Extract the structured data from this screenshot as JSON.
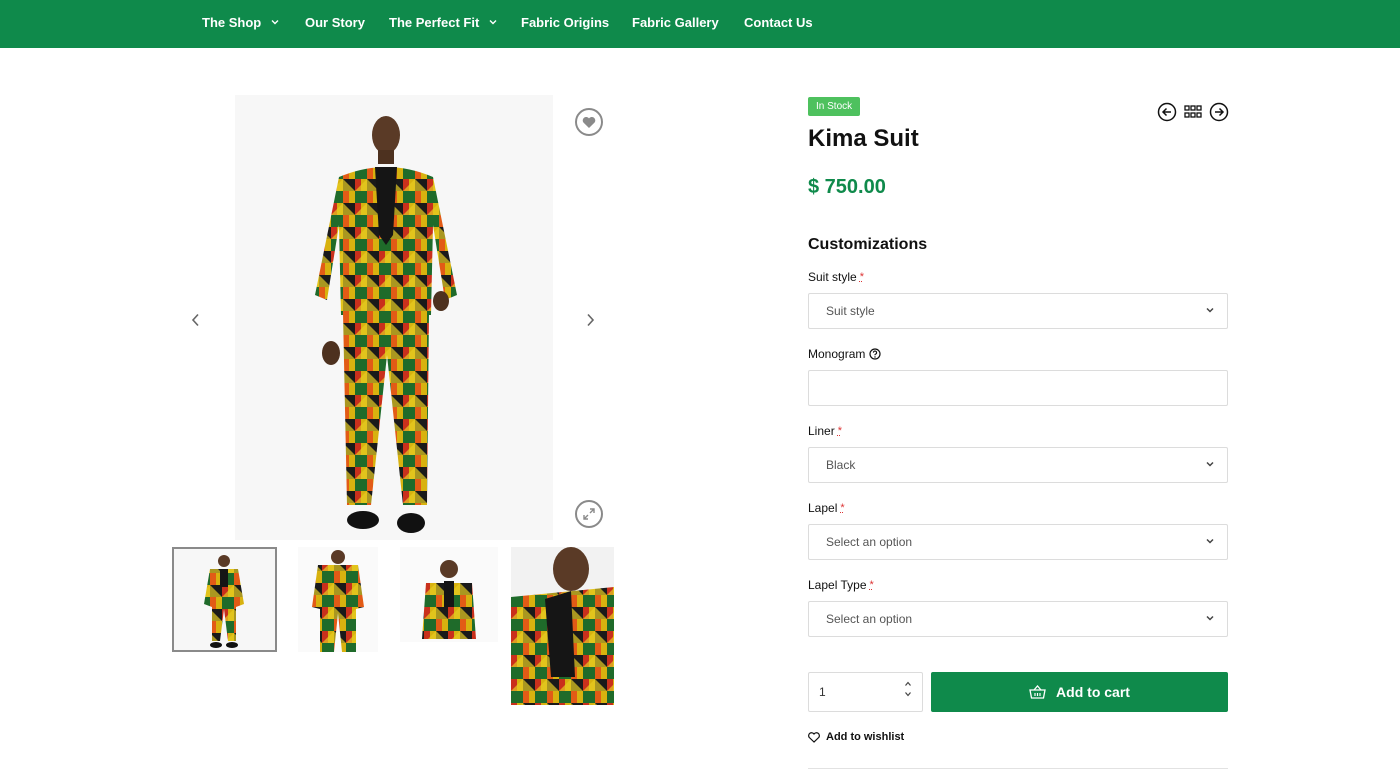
{
  "nav": {
    "items": [
      {
        "label": "The Shop",
        "has_dropdown": true
      },
      {
        "label": "Our Story",
        "has_dropdown": false
      },
      {
        "label": "The Perfect Fit",
        "has_dropdown": true
      },
      {
        "label": "Fabric Origins",
        "has_dropdown": false
      },
      {
        "label": "Fabric Gallery",
        "has_dropdown": false
      },
      {
        "label": "Contact Us",
        "has_dropdown": false
      }
    ]
  },
  "product": {
    "stock_badge": "In Stock",
    "title": "Kima Suit",
    "price": "$ 750.00"
  },
  "customizations": {
    "heading": "Customizations",
    "suit_style": {
      "label": "Suit style",
      "required": "*",
      "value": "Suit style"
    },
    "monogram": {
      "label": "Monogram",
      "value": ""
    },
    "liner": {
      "label": "Liner",
      "required": "*",
      "value": "Black"
    },
    "lapel": {
      "label": "Lapel",
      "required": "*",
      "value": "Select an option"
    },
    "lapel_type": {
      "label": "Lapel Type",
      "required": "*",
      "value": "Select an option"
    }
  },
  "cart": {
    "quantity": "1",
    "add_to_cart_label": "Add to cart",
    "wishlist_label": "Add to wishlist"
  },
  "icons": {
    "wishlist": "heart-icon",
    "zoom": "expand-icon",
    "prev": "chevron-left-icon",
    "next": "chevron-right-icon",
    "basket": "basket-icon",
    "grid": "grid-icon",
    "help": "question-circle-icon"
  },
  "colors": {
    "brand_green": "#0f8a4b",
    "stock_green": "#4ec15e",
    "required_red": "#d33333",
    "border": "#dcdcdc"
  }
}
